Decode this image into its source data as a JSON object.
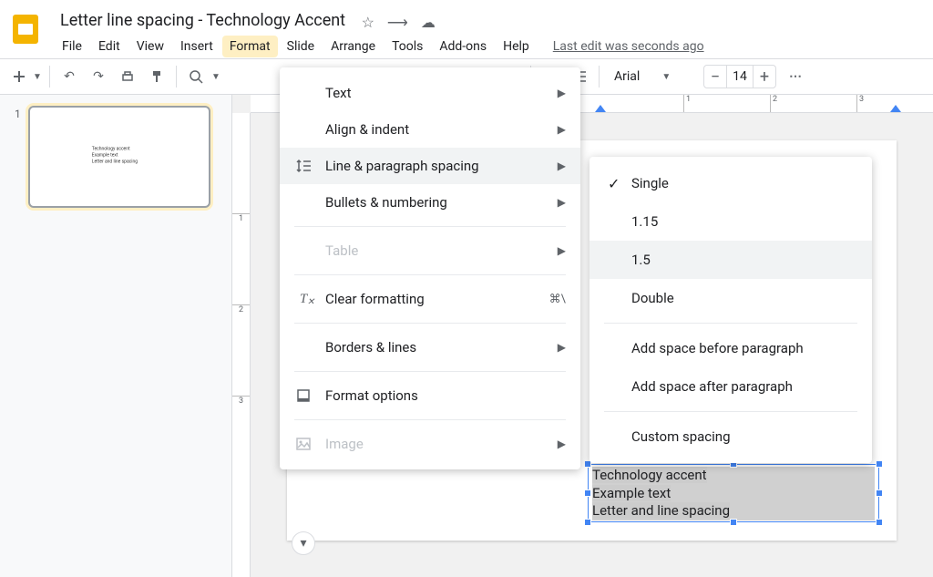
{
  "doc_title": "Letter line spacing - Technology Accent",
  "menubar": {
    "items": [
      "File",
      "Edit",
      "View",
      "Insert",
      "Format",
      "Slide",
      "Arrange",
      "Tools",
      "Add-ons",
      "Help"
    ],
    "active_index": 4,
    "last_edit": "Last edit was seconds ago"
  },
  "toolbar": {
    "font_name": "Arial",
    "font_size": "14"
  },
  "filmstrip": {
    "slides": [
      {
        "number": "1",
        "lines": [
          "Technology accent",
          "Example text",
          "Letter and line spacing"
        ]
      }
    ]
  },
  "textbox": {
    "lines": [
      "Technology accent",
      "Example text",
      "Letter and line spacing"
    ]
  },
  "format_menu": {
    "items": [
      {
        "label": "Text",
        "icon": "",
        "arrow": true
      },
      {
        "label": "Align & indent",
        "icon": "",
        "arrow": true
      },
      {
        "label": "Line & paragraph spacing",
        "icon": "spacing",
        "arrow": true,
        "hover": true
      },
      {
        "label": "Bullets & numbering",
        "icon": "",
        "arrow": true
      },
      {
        "sep": true
      },
      {
        "label": "Table",
        "icon": "",
        "arrow": true,
        "disabled": true
      },
      {
        "sep": true
      },
      {
        "label": "Clear formatting",
        "icon": "clear",
        "shortcut": "⌘\\"
      },
      {
        "sep": true
      },
      {
        "label": "Borders & lines",
        "icon": "",
        "arrow": true
      },
      {
        "sep": true
      },
      {
        "label": "Format options",
        "icon": "options"
      },
      {
        "sep": true
      },
      {
        "label": "Image",
        "icon": "image",
        "arrow": true,
        "disabled": true
      }
    ]
  },
  "spacing_submenu": {
    "items": [
      {
        "label": "Single",
        "checked": true
      },
      {
        "label": "1.15"
      },
      {
        "label": "1.5",
        "hover": true
      },
      {
        "label": "Double"
      },
      {
        "sep": true
      },
      {
        "label": "Add space before paragraph"
      },
      {
        "label": "Add space after paragraph"
      },
      {
        "sep": true
      },
      {
        "label": "Custom spacing"
      }
    ]
  },
  "ruler": {
    "h_numbers": [
      "1",
      "2",
      "3"
    ],
    "v_numbers": [
      "1",
      "2",
      "3"
    ]
  }
}
